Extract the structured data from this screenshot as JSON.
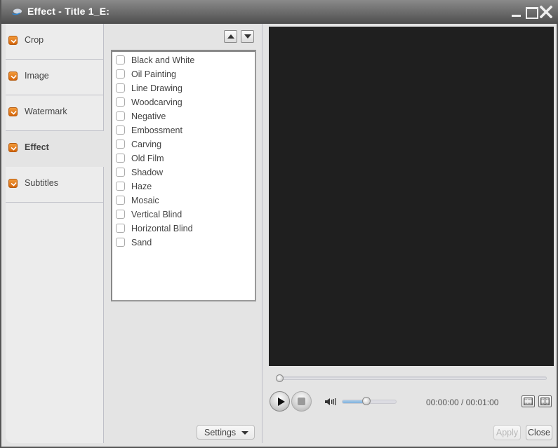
{
  "window": {
    "title": "Effect - Title 1_E:",
    "app_icon": "app-logo-icon",
    "controls": [
      "minimize-icon",
      "maximize-icon",
      "close-icon"
    ]
  },
  "sidebar": {
    "items": [
      {
        "label": "Crop",
        "checked": true,
        "active": false
      },
      {
        "label": "Image",
        "checked": true,
        "active": false
      },
      {
        "label": "Watermark",
        "checked": true,
        "active": false
      },
      {
        "label": "Effect",
        "checked": true,
        "active": true
      },
      {
        "label": "Subtitles",
        "checked": true,
        "active": false
      }
    ]
  },
  "effects": {
    "order_up_icon": "triangle-up-icon",
    "order_down_icon": "triangle-down-icon",
    "items": [
      {
        "label": "Black and White",
        "checked": false
      },
      {
        "label": "Oil Painting",
        "checked": false
      },
      {
        "label": "Line Drawing",
        "checked": false
      },
      {
        "label": "Woodcarving",
        "checked": false
      },
      {
        "label": "Negative",
        "checked": false
      },
      {
        "label": "Embossment",
        "checked": false
      },
      {
        "label": "Carving",
        "checked": false
      },
      {
        "label": "Old Film",
        "checked": false
      },
      {
        "label": "Shadow",
        "checked": false
      },
      {
        "label": "Haze",
        "checked": false
      },
      {
        "label": "Mosaic",
        "checked": false
      },
      {
        "label": "Vertical Blind",
        "checked": false
      },
      {
        "label": "Horizontal Blind",
        "checked": false
      },
      {
        "label": "Sand",
        "checked": false
      }
    ],
    "settings_label": "Settings"
  },
  "player": {
    "seek_fraction": 0.0,
    "volume_fraction": 0.45,
    "time_current": "00:00:00",
    "time_total": "00:01:00",
    "time_separator": " / ",
    "time_text": "00:00:00 / 00:01:00"
  },
  "footer": {
    "apply_label": "Apply",
    "apply_enabled": false,
    "close_label": "Close"
  },
  "colors": {
    "accent_checkbox": "#e0771c",
    "preview_bg": "#1f1f1f",
    "volume_fill": "#8dbbe2"
  }
}
